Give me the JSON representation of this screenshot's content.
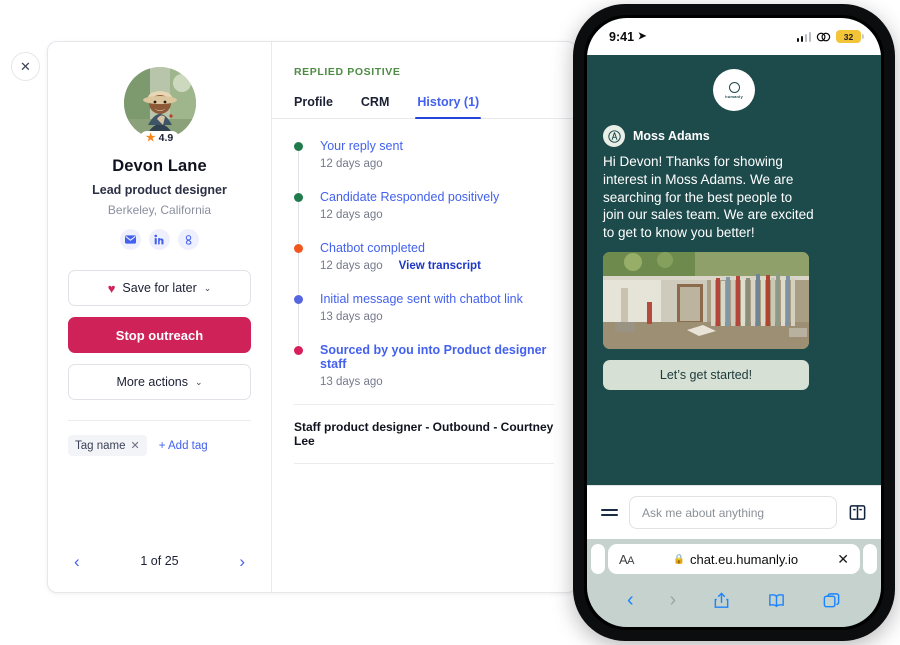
{
  "close_button": {
    "icon": "close-icon",
    "label": "✕"
  },
  "profile": {
    "avatar_alt": "candidate-photo",
    "rating": "4.9",
    "star": "★",
    "name": "Devon Lane",
    "title": "Lead product designer",
    "location": "Berkeley, California",
    "socials": [
      {
        "name": "email-icon",
        "label": "email"
      },
      {
        "name": "linkedin-icon",
        "label": "in"
      },
      {
        "name": "google-icon",
        "label": "g"
      }
    ],
    "save_label": "Save for later",
    "heart": "♥",
    "chevron": "⌄",
    "stop_label": "Stop outreach",
    "more_label": "More actions",
    "tag": "Tag name",
    "tag_remove": "✕",
    "add_tag": "+ Add tag"
  },
  "pagination": {
    "prev": "‹",
    "label": "1 of 25",
    "next": "›"
  },
  "history": {
    "status": "REPLIED POSITIVE",
    "tabs": [
      {
        "label": "Profile",
        "active": false
      },
      {
        "label": "CRM",
        "active": false
      },
      {
        "label": "History (1)",
        "active": true
      }
    ],
    "events": [
      {
        "title": "Your reply sent",
        "time": "12 days ago",
        "color": "#1f7a4d",
        "bold": false,
        "link": ""
      },
      {
        "title": "Candidate Responded positively",
        "time": "12 days ago",
        "color": "#1f7a4d",
        "bold": false,
        "link": ""
      },
      {
        "title": "Chatbot completed",
        "time": "12 days ago",
        "color": "#f1561f",
        "bold": false,
        "link": "View transcript"
      },
      {
        "title": "Initial message sent with chatbot link",
        "time": "13 days ago",
        "color": "#5566e0",
        "bold": false,
        "link": ""
      },
      {
        "title": "Sourced by you into Product designer staff",
        "time": "13 days ago",
        "color": "#d81e5b",
        "bold": true,
        "link": ""
      }
    ],
    "footer": "Staff product designer - Outbound - Courtney Lee"
  },
  "phone": {
    "statusbar": {
      "time": "9:41",
      "location_arrow": "➤",
      "battery": "32"
    },
    "logo": {
      "mark": "humanly-logo",
      "text": "humanly"
    },
    "message": {
      "sender_initial": "A",
      "sender": "Moss Adams",
      "body": "Hi Devon! Thanks for showing interest in Moss Adams. We are searching for the best people to join our sales team. We are excited to get to know you better!",
      "image_alt": "office-bookshelf-photo",
      "cta": "Let’s get started!"
    },
    "input": {
      "menu_icon": "hamburger-menu-icon",
      "placeholder": "Ask me about anything",
      "book_icon": "book-icon"
    },
    "browser": {
      "aa_label": "ᴀA",
      "lock": "🔒",
      "url": "chat.eu.humanly.io",
      "close": "✕",
      "back": "‹",
      "forward": "›",
      "share_icon": "share-icon",
      "bookmarks_icon": "bookmarks-icon",
      "tabs_icon": "tabs-icon"
    }
  },
  "colors": {
    "accent_pink": "#cf2259",
    "accent_blue": "#4361ee",
    "teal": "#1d4a4b",
    "green": "#4e8b45"
  }
}
